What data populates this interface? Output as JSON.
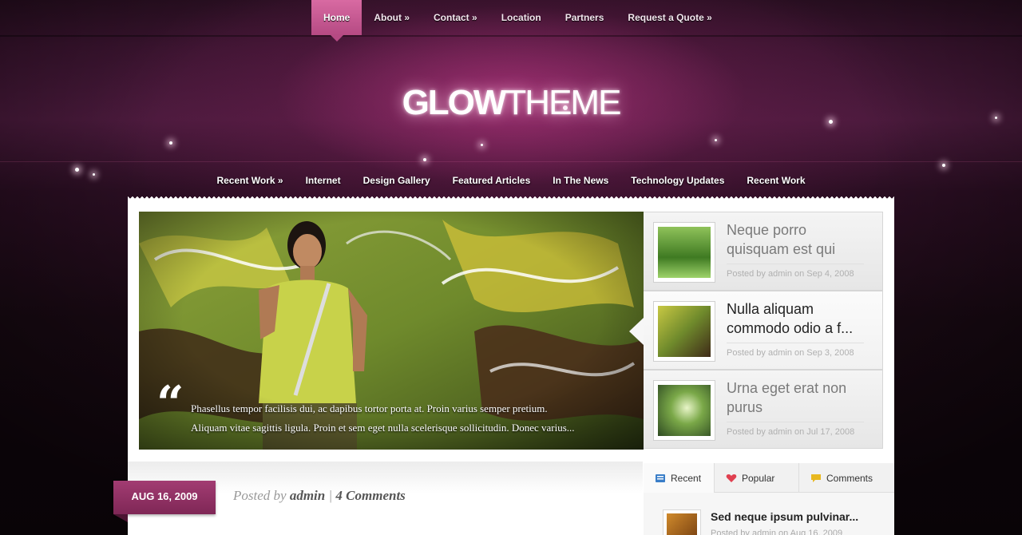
{
  "top_nav": {
    "items": [
      {
        "label": "Home",
        "active": true
      },
      {
        "label": "About »"
      },
      {
        "label": "Contact »"
      },
      {
        "label": "Location"
      },
      {
        "label": "Partners"
      },
      {
        "label": "Request a Quote »"
      }
    ]
  },
  "logo": {
    "part1": "GLOW",
    "part2": "THEME"
  },
  "sub_nav": {
    "items": [
      "Recent Work »",
      "Internet",
      "Design Gallery",
      "Featured Articles",
      "In The News",
      "Technology Updates",
      "Recent Work"
    ]
  },
  "feature": {
    "quote_mark": "“",
    "excerpt_line1": "Phasellus tempor facilisis dui, ac dapibus tortor porta at. Proin varius semper pretium.",
    "excerpt_line2": "Aliquam vitae sagittis ligula. Proin et sem eget nulla scelerisque sollicitudin. Donec varius..."
  },
  "side_list": [
    {
      "title": "Neque porro quisquam est qui",
      "meta": "Posted by admin on Sep 4, 2008"
    },
    {
      "title": "Nulla aliquam commodo odio a f...",
      "meta": "Posted by admin on Sep 3, 2008",
      "active": true
    },
    {
      "title": "Urna eget erat non purus",
      "meta": "Posted by admin on Jul 17, 2008"
    }
  ],
  "post": {
    "date": "AUG 16, 2009",
    "posted_by": "Posted by",
    "author": "admin",
    "separator": "|",
    "comments": "4 Comments"
  },
  "sidebar_tabs": [
    {
      "label": "Recent",
      "icon": "document-icon",
      "color": "#3a7ec8"
    },
    {
      "label": "Popular",
      "icon": "heart-icon",
      "color": "#e04050"
    },
    {
      "label": "Comments",
      "icon": "speech-bubble-icon",
      "color": "#e8b820"
    }
  ],
  "sidebar_post": {
    "title": "Sed neque ipsum pulvinar...",
    "meta": "Posted by admin on Aug 16, 2009"
  },
  "colors": {
    "accent": "#b54a83",
    "badge": "#8e2f62"
  }
}
